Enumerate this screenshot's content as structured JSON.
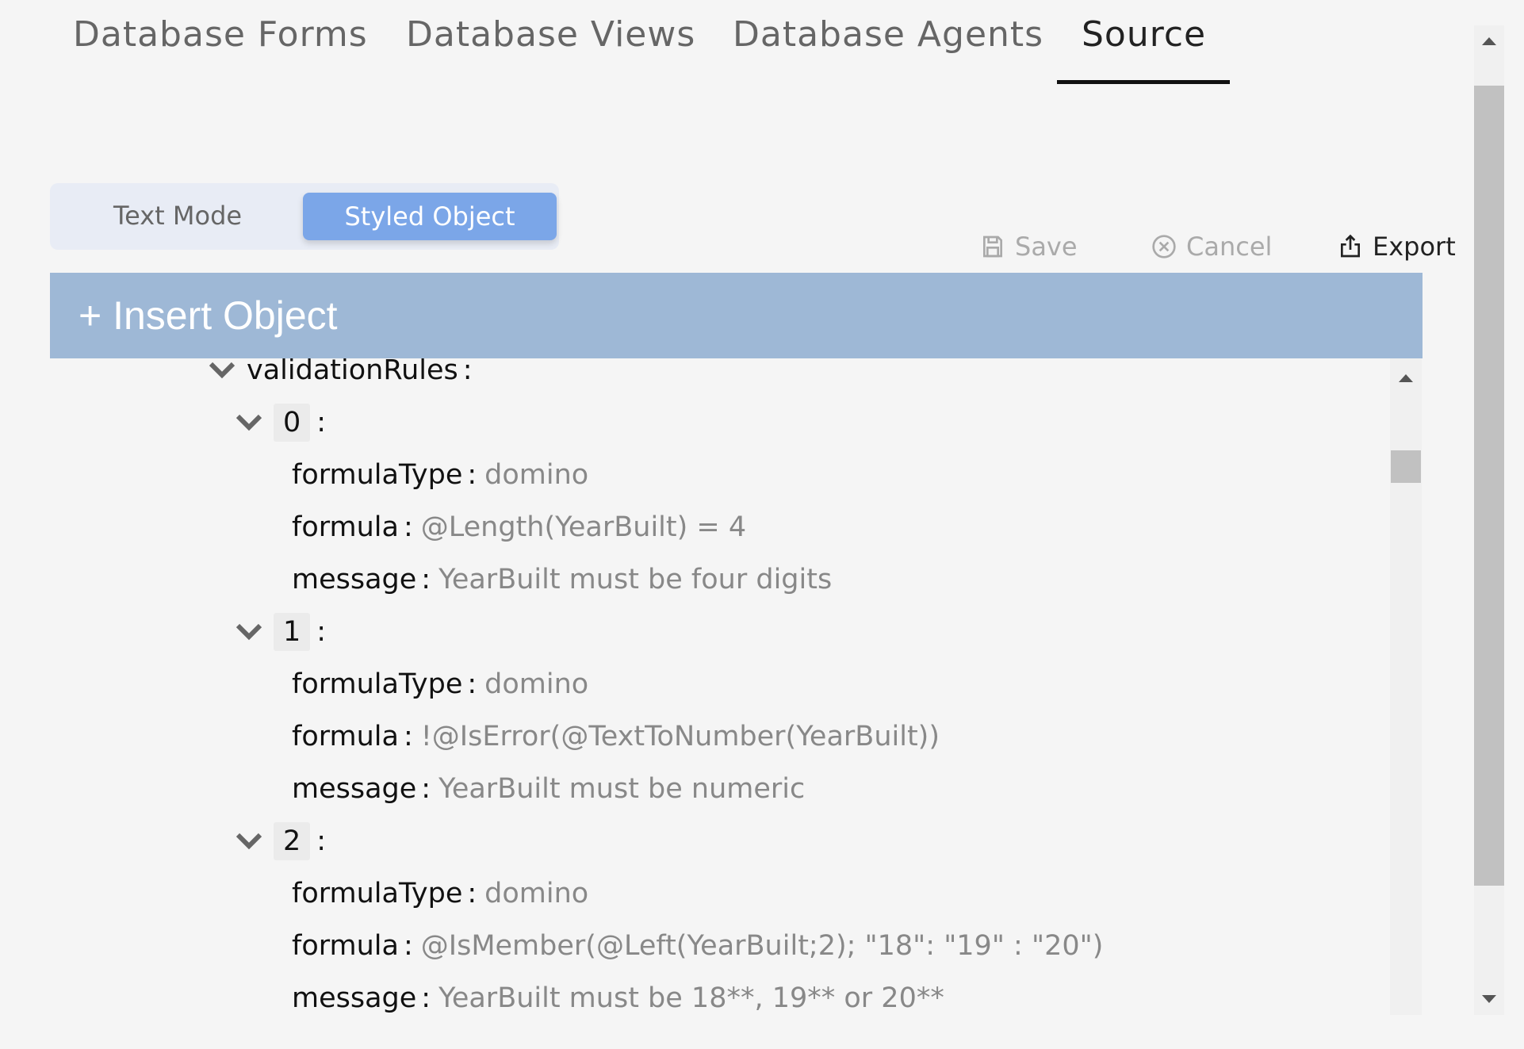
{
  "tabs": [
    {
      "label": "Database Forms",
      "active": false
    },
    {
      "label": "Database Views",
      "active": false
    },
    {
      "label": "Database Agents",
      "active": false
    },
    {
      "label": "Source",
      "active": true
    }
  ],
  "mode_toggle": {
    "text_mode": "Text Mode",
    "styled_object": "Styled Object",
    "selected": "Styled Object"
  },
  "actions": {
    "save": "Save",
    "cancel": "Cancel",
    "export": "Export",
    "save_icon": "floppy-disk-icon",
    "cancel_icon": "circle-x-icon",
    "export_icon": "share-upload-icon"
  },
  "insert_object": "+ Insert Object",
  "colors": {
    "accent": "#7ba6e8",
    "insert_bar": "#9eb8d6",
    "background": "#f5f5f5"
  },
  "tree": {
    "root_key": "validationRules",
    "items": [
      {
        "index": "0",
        "formulaType": "domino",
        "formula": "@Length(YearBuilt) = 4",
        "message": "YearBuilt must be four digits"
      },
      {
        "index": "1",
        "formulaType": "domino",
        "formula": "!@IsError(@TextToNumber(YearBuilt))",
        "message": "YearBuilt must be numeric"
      },
      {
        "index": "2",
        "formulaType": "domino",
        "formula": "@IsMember(@Left(YearBuilt;2); \"18\": \"19\" : \"20\")",
        "message": "YearBuilt must be 18**, 19** or 20**"
      }
    ],
    "labels": {
      "formulaType": "formulaType",
      "formula": "formula",
      "message": "message",
      "sep": ":"
    }
  }
}
